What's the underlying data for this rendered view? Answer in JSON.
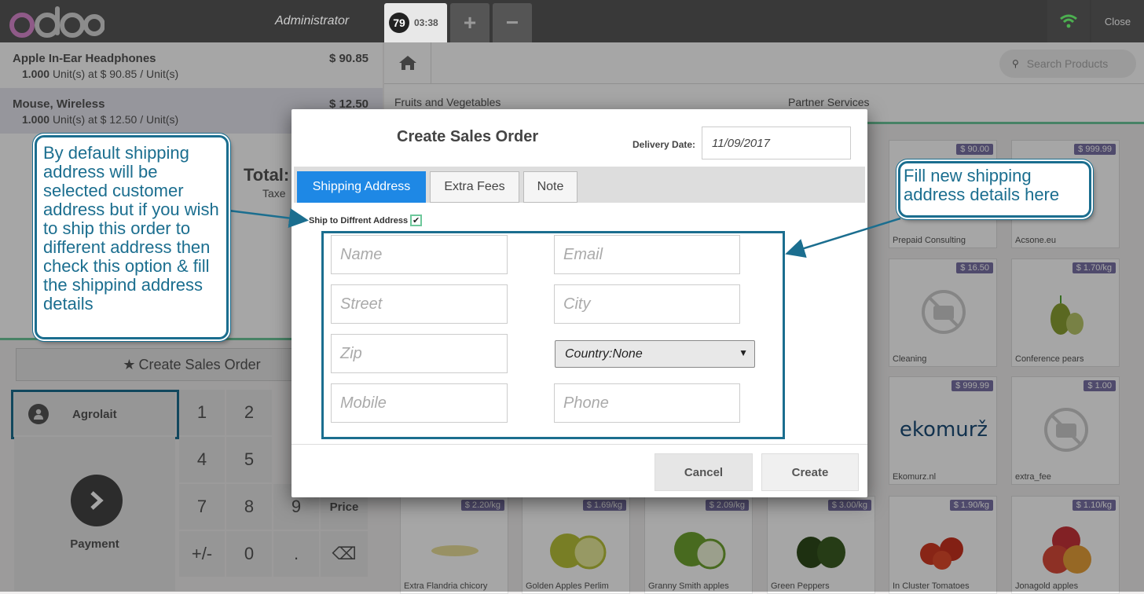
{
  "topbar": {
    "logo": "odoo",
    "user": "Administrator",
    "order_tab_number": "79",
    "order_tab_time": "03:38",
    "plus_label": "+",
    "minus_label": "−",
    "close_label": "Close"
  },
  "order": {
    "lines": [
      {
        "name": "Apple In-Ear Headphones",
        "price": "$ 90.85",
        "qty": "1.000",
        "detail": "Unit(s) at $ 90.85 / Unit(s)"
      },
      {
        "name": "Mouse, Wireless",
        "price": "$ 12.50",
        "qty": "1.000",
        "detail": "Unit(s) at $ 12.50 / Unit(s)"
      }
    ],
    "total_label": "Total:",
    "taxes_label": "Taxe"
  },
  "actions": {
    "create_sales_order": "Create Sales Order",
    "customer": "Agrolait",
    "payment": "Payment"
  },
  "numpad": {
    "keys": [
      "1",
      "2",
      "4",
      "5",
      "7",
      "8",
      "9",
      "+/-",
      "0",
      "."
    ],
    "price_label": "Price",
    "backspace": "⌫"
  },
  "products": {
    "search_placeholder": "Search Products",
    "categories": [
      "Fruits and Vegetables",
      "Partner Services"
    ],
    "items": [
      {
        "name": "Prepaid Consulting",
        "price": "$ 90.00"
      },
      {
        "name": "Acsone.eu",
        "price": "$ 999.99"
      },
      {
        "name": "Cleaning",
        "price": "$ 16.50"
      },
      {
        "name": "Conference pears",
        "price": "$ 1.70/kg"
      },
      {
        "name": "Ekomurz.nl",
        "price": "$ 999.99"
      },
      {
        "name": "extra_fee",
        "price": "$ 1.00"
      },
      {
        "name": "Extra Flandria chicory",
        "price": "$ 2.20/kg"
      },
      {
        "name": "Golden Apples Perlim",
        "price": "$ 1.69/kg"
      },
      {
        "name": "Granny Smith apples",
        "price": "$ 2.09/kg"
      },
      {
        "name": "Green Peppers",
        "price": "$ 3.00/kg"
      },
      {
        "name": "In Cluster Tomatoes",
        "price": "$ 1.90/kg"
      },
      {
        "name": "Jonagold apples",
        "price": "$ 1.10/kg"
      }
    ],
    "ekomurz_logo": "ekomurž"
  },
  "modal": {
    "title": "Create Sales Order",
    "delivery_label": "Delivery Date:",
    "delivery_value": "11/09/2017",
    "tabs": [
      "Shipping Address",
      "Extra Fees",
      "Note"
    ],
    "ship_diff_label": "Ship to Diffrent Address",
    "ship_diff_checked": "✔",
    "fields": {
      "name": "Name",
      "email": "Email",
      "street": "Street",
      "city": "City",
      "zip": "Zip",
      "country": "Country:None",
      "mobile": "Mobile",
      "phone": "Phone"
    },
    "cancel": "Cancel",
    "create": "Create"
  },
  "callouts": {
    "left": "By default shipping address will be selected customer address but if you wish to ship this order to different address then check this option & fill the shippind address details",
    "right": "Fill new shipping address details here"
  },
  "colors": {
    "accent": "#1e88e5",
    "annotation": "#1b6e8f",
    "price_badge": "#7a72a6",
    "topbar": "#393939"
  }
}
